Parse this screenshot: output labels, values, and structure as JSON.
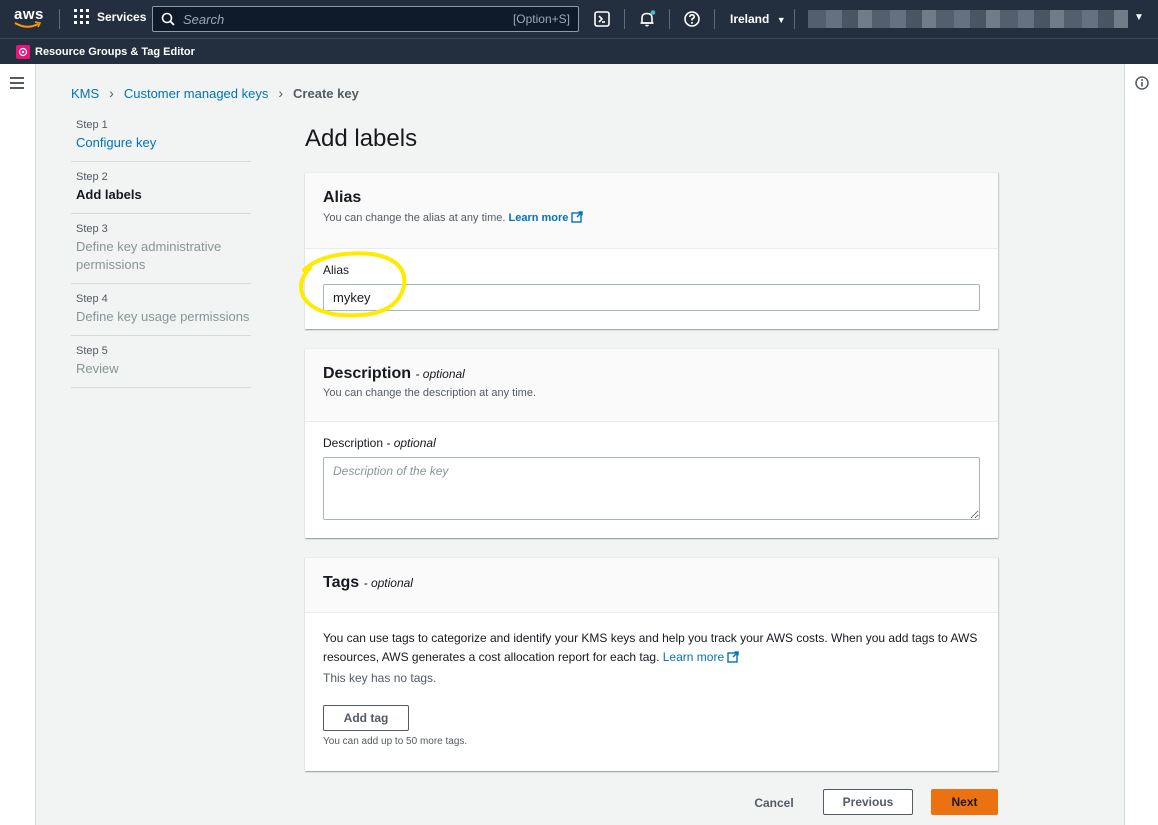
{
  "topbar": {
    "logo_text": "aws",
    "services_label": "Services",
    "search_placeholder": "Search",
    "search_shortcut": "[Option+S]",
    "region_label": "Ireland"
  },
  "secondbar": {
    "label": "Resource Groups & Tag Editor"
  },
  "breadcrumb": {
    "items": [
      "KMS",
      "Customer managed keys",
      "Create key"
    ]
  },
  "steps": [
    {
      "num": "Step 1",
      "label": "Configure key"
    },
    {
      "num": "Step 2",
      "label": "Add labels"
    },
    {
      "num": "Step 3",
      "label": "Define key administrative permissions"
    },
    {
      "num": "Step 4",
      "label": "Define key usage permissions"
    },
    {
      "num": "Step 5",
      "label": "Review"
    }
  ],
  "page_title": "Add labels",
  "alias_panel": {
    "title": "Alias",
    "description": "You can change the alias at any time.",
    "learn_more": "Learn more",
    "field_label": "Alias",
    "field_value": "mykey"
  },
  "description_panel": {
    "title": "Description",
    "title_optional": "- optional",
    "description": "You can change the description at any time.",
    "field_label": "Description",
    "field_optional": "- optional",
    "placeholder": "Description of the key"
  },
  "tags_panel": {
    "title": "Tags",
    "title_optional": "- optional",
    "body_text": "You can use tags to categorize and identify your KMS keys and help you track your AWS costs. When you add tags to AWS resources, AWS generates a cost allocation report for each tag.",
    "learn_more": "Learn more",
    "no_tags": "This key has no tags.",
    "add_tag_label": "Add tag",
    "hint": "You can add up to 50 more tags."
  },
  "footer": {
    "cancel_label": "Cancel",
    "previous_label": "Previous",
    "next_label": "Next"
  },
  "colors": {
    "nav_bg": "#232f3e",
    "link": "#0073bb",
    "primary": "#ec7211",
    "annotation": "#ffeb00"
  }
}
